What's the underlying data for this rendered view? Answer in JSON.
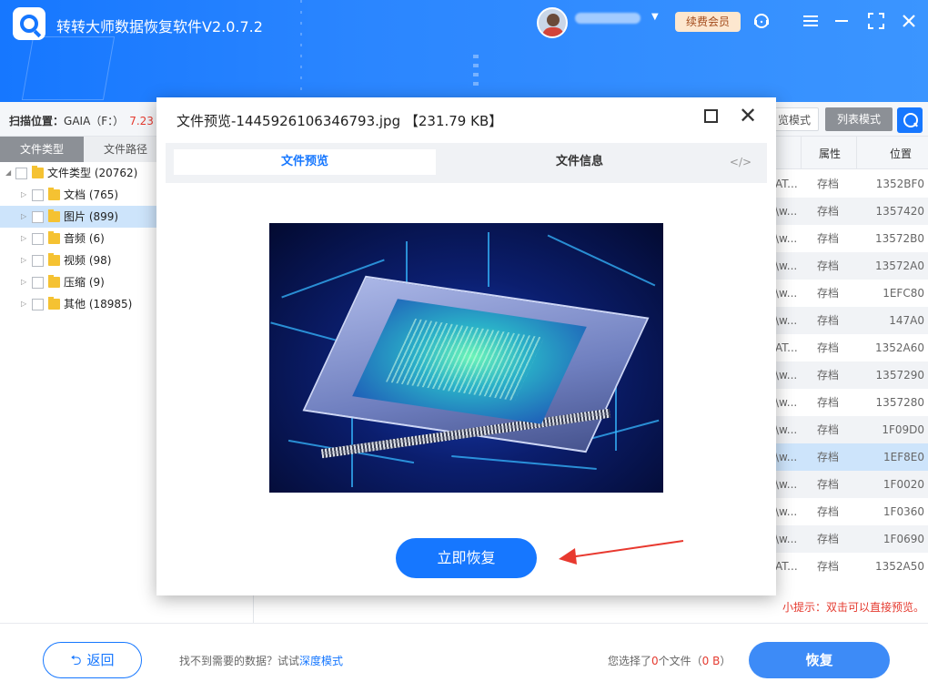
{
  "app": {
    "title": "转转大师数据恢复软件V2.0.7.2",
    "vip_label": "续费会员"
  },
  "scan": {
    "label_prefix": "扫描位置：",
    "location": "GAIA（F：）",
    "size": "7.23"
  },
  "view_modes": {
    "thumb": "览模式",
    "list": "列表模式"
  },
  "left_tabs": {
    "file_type": "文件类型",
    "file_path": "文件路径"
  },
  "tree": [
    {
      "label": "文件类型 (20762)",
      "level": 0
    },
    {
      "label": "文档 (765)",
      "level": 1
    },
    {
      "label": "图片 (899)",
      "level": 1,
      "selected": true
    },
    {
      "label": "音频 (6)",
      "level": 1
    },
    {
      "label": "视频 (98)",
      "level": 1
    },
    {
      "label": "压缩 (9)",
      "level": 1
    },
    {
      "label": "其他 (18985)",
      "level": 1
    }
  ],
  "table": {
    "headers": {
      "attr": "属性",
      "location": "位置"
    },
    "rows": [
      {
        "c0": "AT...",
        "attr": "存档",
        "loc": "1352BF0"
      },
      {
        "c0": "\\w...",
        "attr": "存档",
        "loc": "1357420"
      },
      {
        "c0": "\\w...",
        "attr": "存档",
        "loc": "13572B0"
      },
      {
        "c0": "\\w...",
        "attr": "存档",
        "loc": "13572A0"
      },
      {
        "c0": "\\w...",
        "attr": "存档",
        "loc": "1EFC80"
      },
      {
        "c0": "\\w...",
        "attr": "存档",
        "loc": "147A0"
      },
      {
        "c0": "AT...",
        "attr": "存档",
        "loc": "1352A60"
      },
      {
        "c0": "\\w...",
        "attr": "存档",
        "loc": "1357290"
      },
      {
        "c0": "\\w...",
        "attr": "存档",
        "loc": "1357280"
      },
      {
        "c0": "\\w...",
        "attr": "存档",
        "loc": "1F09D0"
      },
      {
        "c0": "\\w...",
        "attr": "存档",
        "loc": "1EF8E0",
        "highlight": true
      },
      {
        "c0": "\\w...",
        "attr": "存档",
        "loc": "1F0020"
      },
      {
        "c0": "\\w...",
        "attr": "存档",
        "loc": "1F0360"
      },
      {
        "c0": "\\w...",
        "attr": "存档",
        "loc": "1F0690"
      },
      {
        "c0": "AT...",
        "attr": "存档",
        "loc": "1352A50"
      }
    ]
  },
  "tip": "小提示：双击可以直接预览。",
  "bottom": {
    "back_label": "返回",
    "hint_text": "找不到需要的数据？试试",
    "hint_link": "深度模式",
    "selected_prefix": "您选择了",
    "selected_count": "0",
    "selected_mid": "个文件（",
    "selected_size": "0 B",
    "selected_suffix": "）",
    "recover_label": "恢复"
  },
  "modal": {
    "title": "文件预览-1445926106346793.jpg 【231.79 KB】",
    "tab_preview": "文件预览",
    "tab_info": "文件信息",
    "tab_code": "</>",
    "recover_now": "立即恢复"
  },
  "colors": {
    "brand": "#1677ff",
    "warning": "#e53a2f",
    "vip_bg": "#fde7cf"
  }
}
